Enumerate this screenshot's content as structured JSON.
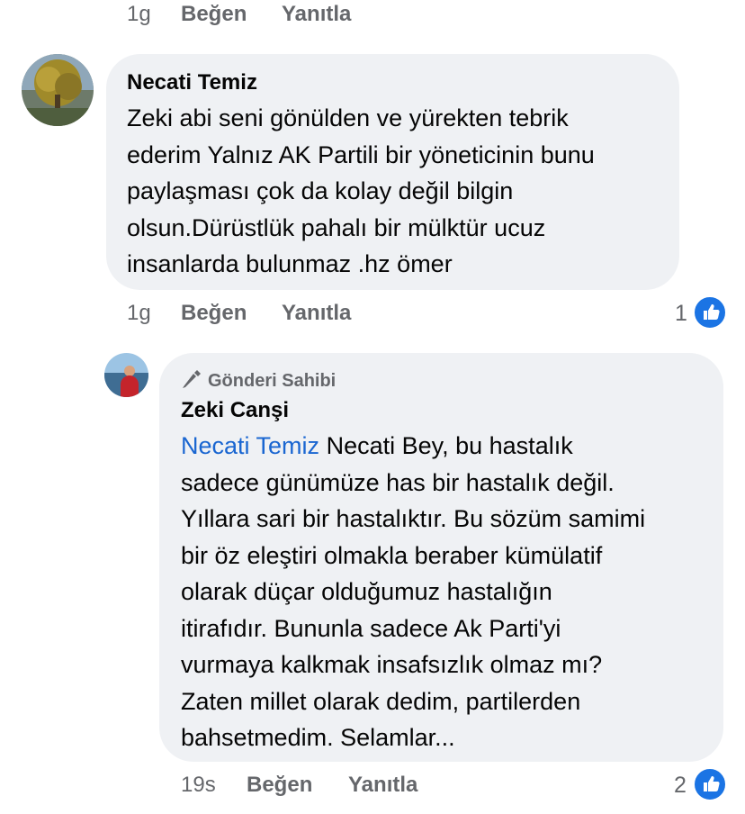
{
  "top_actions": {
    "time": "1g",
    "like": "Beğen",
    "reply": "Yanıtla"
  },
  "comment1": {
    "author": "Necati Temiz",
    "lines": [
      "Zeki abi seni gönülden ve yürekten tebrik",
      "ederim Yalnız AK Partili bir yöneticinin bunu",
      "paylaşması çok da kolay değil bilgin",
      "olsun.Dürüstlük pahalı bir mülktür ucuz",
      "insanlarda bulunmaz .hz ömer"
    ],
    "time": "1g",
    "like": "Beğen",
    "reply": "Yanıtla",
    "reaction_count": "1"
  },
  "reply1": {
    "badge": "Gönderi Sahibi",
    "author": "Zeki Canşi",
    "mention": "Necati Temiz",
    "first_line_rest": " Necati Bey, bu hastalık",
    "lines": [
      "sadece günümüze has bir hastalık değil.",
      "Yıllara sari bir hastalıktır. Bu sözüm samimi",
      "bir öz eleştiri olmakla beraber kümülatif",
      "olarak düçar olduğumuz hastalığın",
      "itirafıdır. Bununla sadece Ak Parti'yi",
      "vurmaya kalkmak insafsızlık olmaz mı?",
      "Zaten millet olarak dedim, partilerden",
      "bahsetmedim. Selamlar..."
    ],
    "time": "19s",
    "like": "Beğen",
    "reply": "Yanıtla",
    "reaction_count": "2"
  },
  "icons": {
    "like": "thumbs-up-icon",
    "badge": "pen-icon"
  },
  "colors": {
    "bubble": "#eff1f4",
    "mention": "#1a66d1",
    "like_badge": "#1b74e4",
    "meta": "#65676b"
  }
}
